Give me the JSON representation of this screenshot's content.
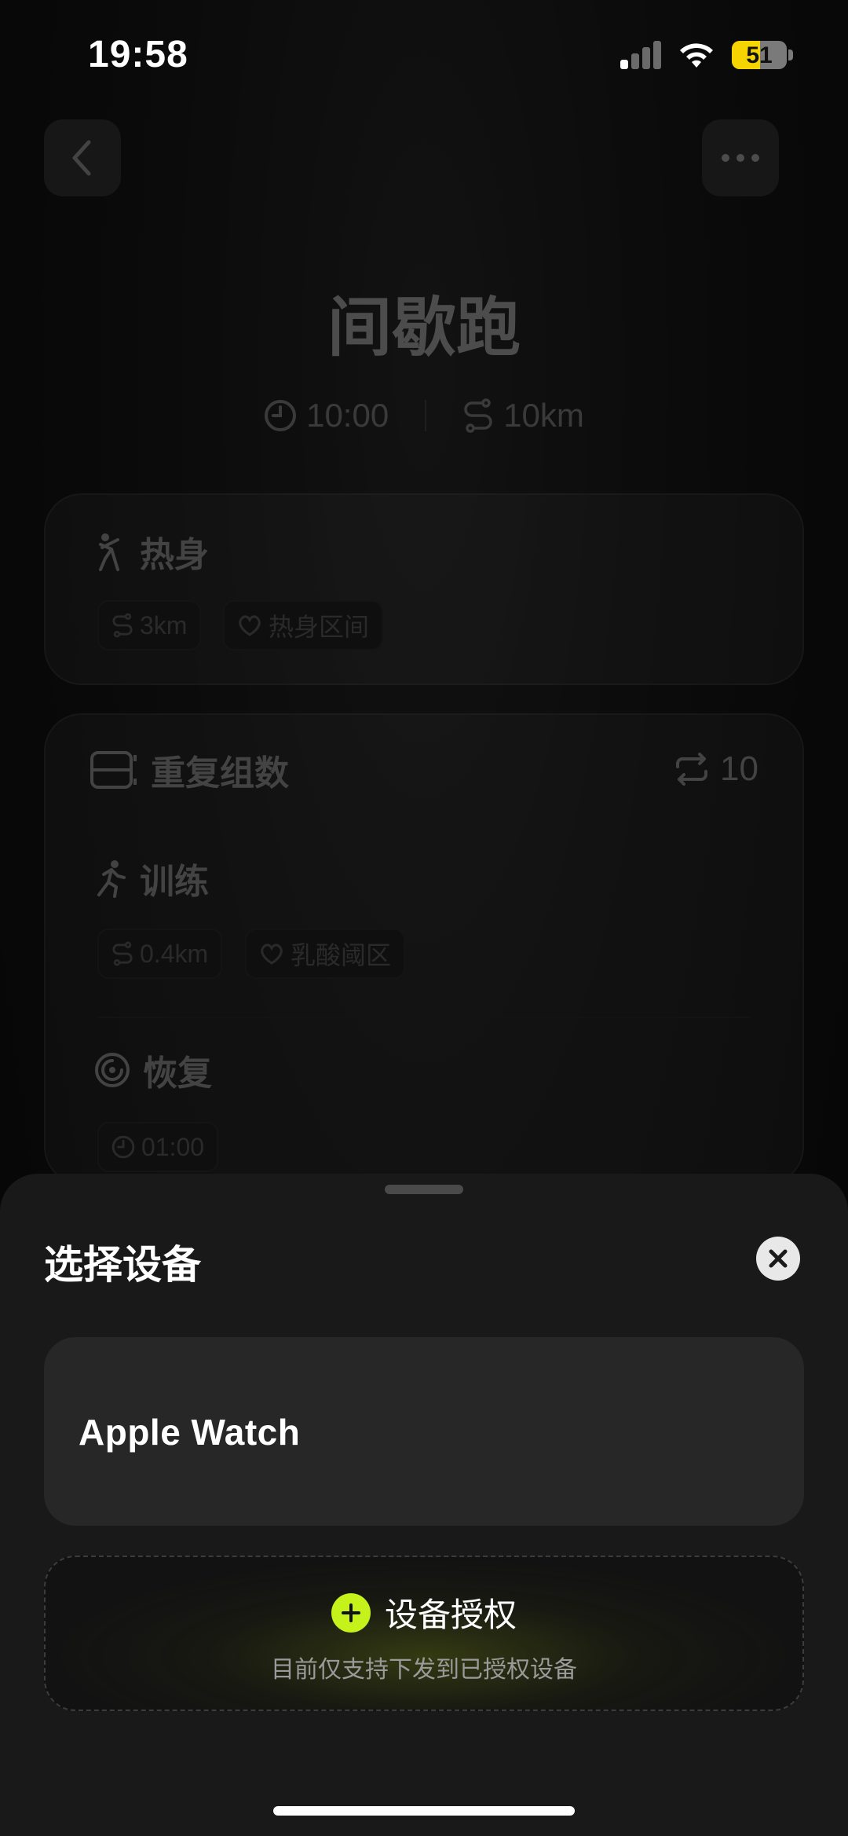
{
  "status_bar": {
    "time": "19:58",
    "battery": "51",
    "battery_color": "#f5d400"
  },
  "workout": {
    "title": "间歇跑",
    "duration": "10:00",
    "distance": "10km"
  },
  "warmup": {
    "label": "热身",
    "distance": "3km",
    "heart_zone": "热身区间"
  },
  "repeat": {
    "label": "重复组数",
    "count": "10",
    "train": {
      "label": "训练",
      "distance": "0.4km",
      "heart_zone": "乳酸阈区"
    },
    "recover": {
      "label": "恢复",
      "duration": "01:00"
    }
  },
  "sheet": {
    "title": "选择设备",
    "device_name": "Apple Watch",
    "auth_label": "设备授权",
    "auth_note": "目前仅支持下发到已授权设备",
    "accent": "#c6f21b"
  },
  "icons": [
    "chevron-left-icon",
    "more-icon",
    "clock-icon",
    "route-icon",
    "warmup-icon",
    "heart-icon",
    "repeat-frame-icon",
    "loop-icon",
    "run-icon",
    "recover-icon",
    "close-icon",
    "plus-icon"
  ]
}
